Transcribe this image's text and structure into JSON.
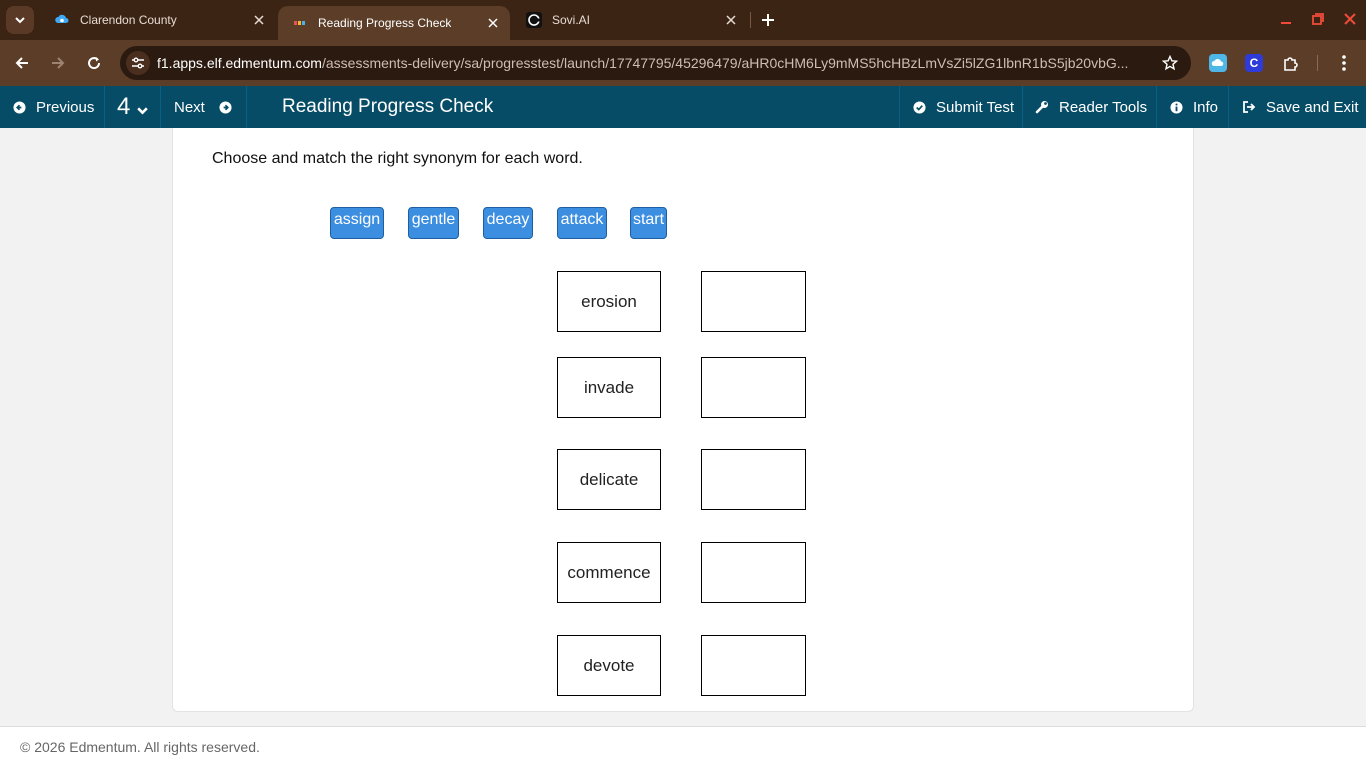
{
  "browser": {
    "tabs": [
      {
        "title": "Clarendon County",
        "icon": "cloud-sync-icon",
        "active": false
      },
      {
        "title": "Reading Progress Check",
        "icon": "edmentum-icon",
        "active": true
      },
      {
        "title": "Sovi.AI",
        "icon": "sovi-icon",
        "active": false
      }
    ],
    "url_host": "f1.apps.elf.edmentum.com",
    "url_path": "/assessments-delivery/sa/progresstest/launch/17747795/45296479/aHR0cHM6Ly9mMS5hcHBzLmVsZi5lZG1lbnR1bS5jb20vbG...",
    "extension_c_label": "C"
  },
  "header": {
    "previous_label": "Previous",
    "question_number": "4",
    "next_label": "Next",
    "test_title": "Reading Progress Check",
    "submit_label": "Submit Test",
    "reader_tools_label": "Reader Tools",
    "info_label": "Info",
    "save_exit_label": "Save and Exit"
  },
  "question": {
    "prompt": "Choose and match the right synonym for each word.",
    "options": [
      "assign",
      "gentle",
      "decay",
      "attack",
      "start"
    ],
    "words": [
      "erosion",
      "invade",
      "delicate",
      "commence",
      "devote"
    ]
  },
  "footer": {
    "copyright": "© 2026 Edmentum. All rights reserved."
  },
  "colors": {
    "tabstrip": "#3c2415",
    "toolbar": "#5b3d28",
    "appbar": "#064c66",
    "chip": "#3b8ee0"
  }
}
